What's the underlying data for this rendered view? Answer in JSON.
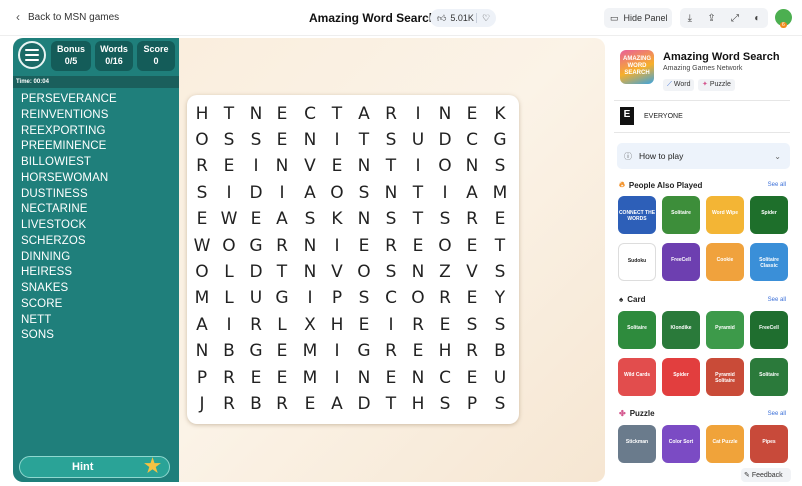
{
  "topbar": {
    "back_label": "Back to MSN games",
    "title": "Amazing Word Search",
    "likes": "5.01K",
    "hide_panel_label": "Hide Panel",
    "avatar_badge": "6"
  },
  "game": {
    "stats": [
      {
        "label": "Bonus",
        "value": "0/5"
      },
      {
        "label": "Words",
        "value": "0/16"
      },
      {
        "label": "Score",
        "value": "0"
      }
    ],
    "time": "Time: 00:04",
    "words": [
      "PERSEVERANCE",
      "REINVENTIONS",
      "REEXPORTING",
      "PREEMINENCE",
      "BILLOWIEST",
      "HORSEWOMAN",
      "DUSTINESS",
      "NECTARINE",
      "LIVESTOCK",
      "SCHERZOS",
      "DINNING",
      "HEIRESS",
      "SNAKES",
      "SCORE",
      "NETT",
      "SONS"
    ],
    "hint_label": "Hint",
    "grid": [
      "HTNECTARINEK",
      "OSSENITSUDCG",
      "REINVENTIONS",
      "SIDIAOSNTIAM",
      "EWEASKNSTSRE",
      "WOGRNIEREOET",
      "OLDTNVOSNZVS",
      "MLUGIPSCOREY",
      "AIRLXHEIRESS",
      "NBGEMIGREHRB",
      "PREEMINENCEU",
      "JRBREADTHSPS"
    ]
  },
  "panel": {
    "app_name": "Amazing Word Search",
    "publisher": "Amazing Games Network",
    "icon_text": "AMAZING WORD SEARCH",
    "tags": [
      "Word",
      "Puzzle"
    ],
    "esrb_letter": "E",
    "rating": "EVERYONE",
    "how_to_play": "How to play",
    "sections": [
      {
        "title": "People Also Played",
        "see_all": "See all",
        "games": [
          "CONNECT THE WORDS",
          "Solitaire",
          "Word Wipe",
          "Spider",
          "Sudoku",
          "FreeCell",
          "Cookie",
          "Solitaire Classic"
        ]
      },
      {
        "title": "Card",
        "see_all": "See all",
        "games": [
          "Solitaire",
          "Klondike",
          "Pyramid",
          "FreeCell",
          "Wild Cards",
          "Spider",
          "Pyramid Solitaire",
          "Solitaire"
        ]
      },
      {
        "title": "Puzzle",
        "see_all": "See all",
        "games": [
          "Stickman",
          "Color Sort",
          "Cat Puzzle",
          "Pipes"
        ]
      }
    ],
    "feedback_label": "Feedback"
  },
  "colors": {
    "panel_teal": "#1f7f7b",
    "accent_orange": "#f28b1d",
    "link_blue": "#3a6fd8"
  }
}
